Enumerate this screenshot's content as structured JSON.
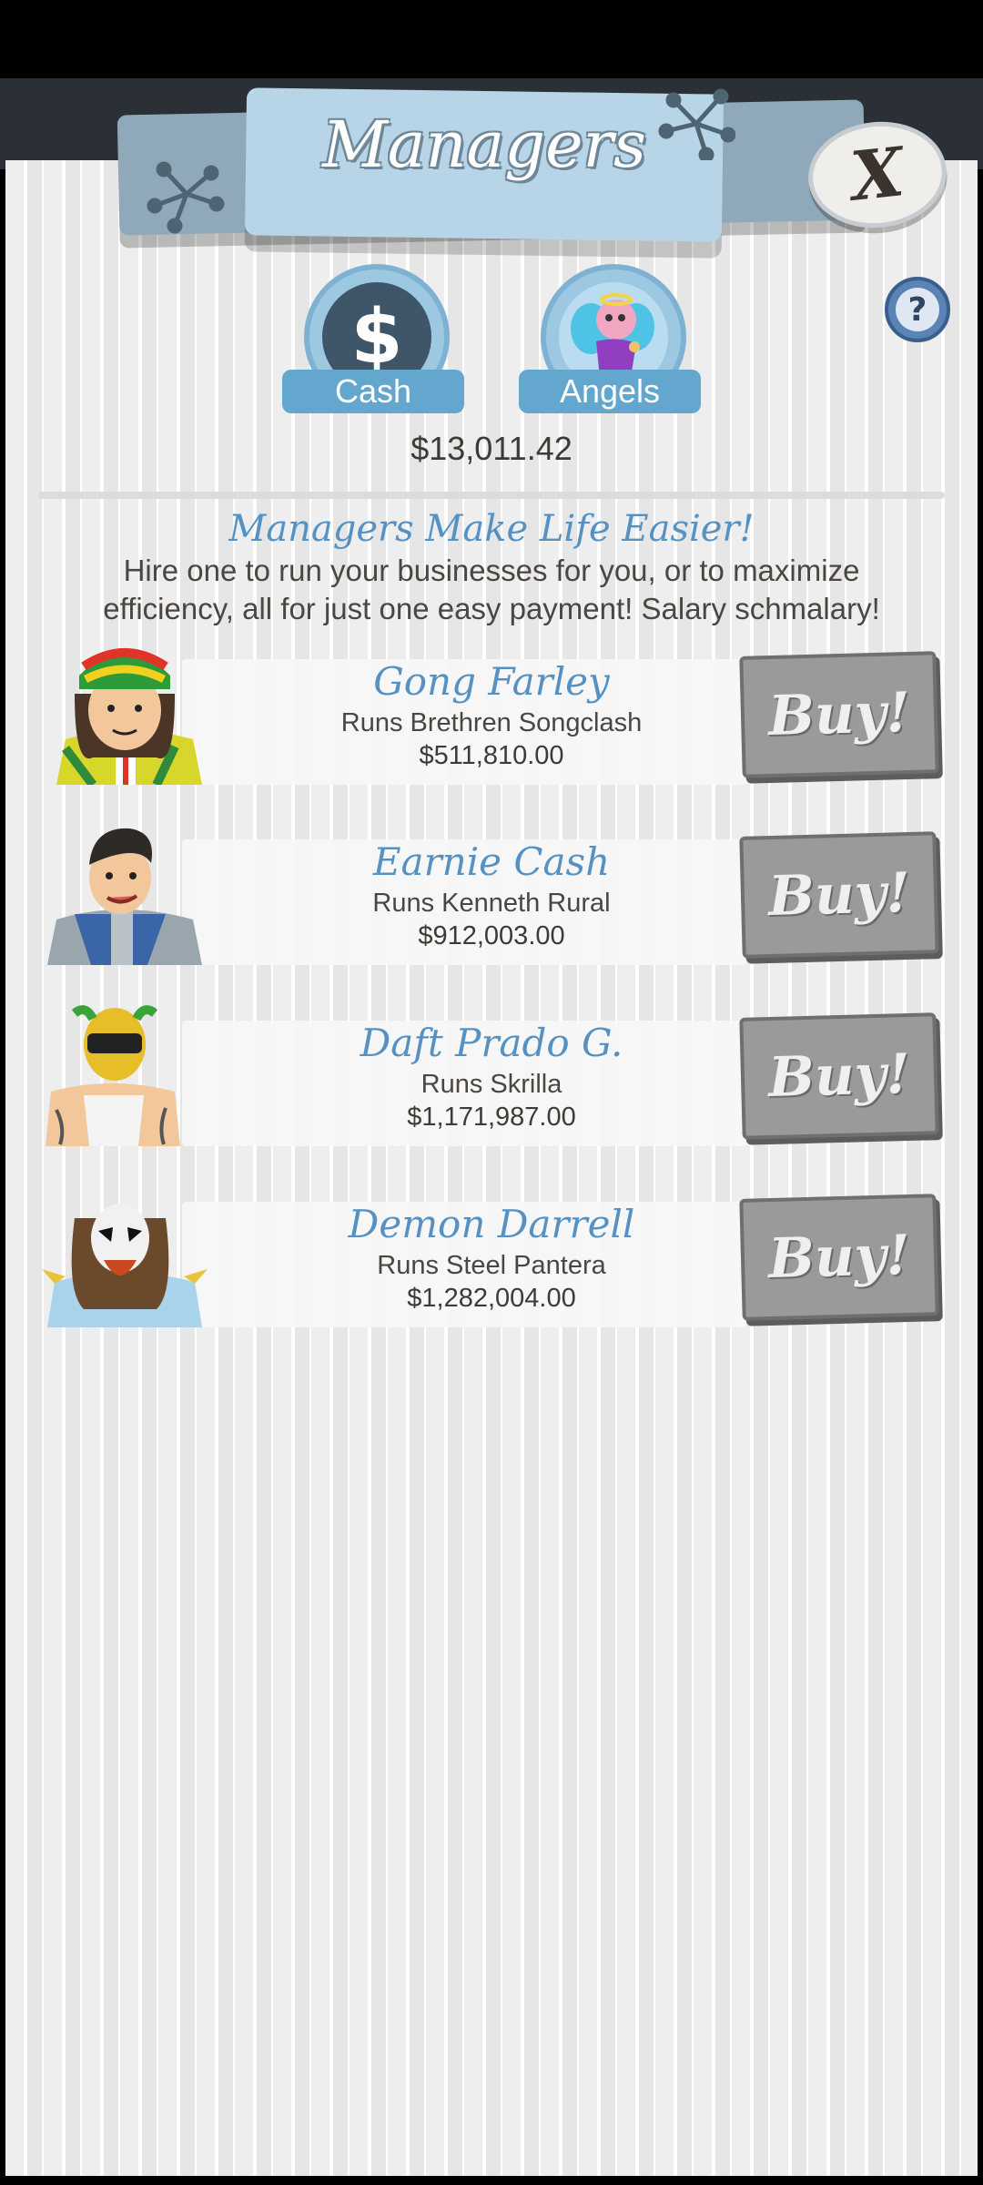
{
  "header": {
    "title": "Managers",
    "close_label": "X",
    "help_label": "?"
  },
  "tabs": [
    {
      "label": "Cash",
      "icon": "dollar-icon"
    },
    {
      "label": "Angels",
      "icon": "angel-icon"
    }
  ],
  "balance": "$13,011.42",
  "promo": {
    "title": "Managers Make Life Easier!",
    "text": "Hire one to run your businesses for you, or to maximize efficiency, all for just one easy payment! Salary schmalary!"
  },
  "managers": [
    {
      "name": "Gong Farley",
      "runs": "Runs Brethren Songclash",
      "price": "$511,810.00",
      "buy_label": "Buy!"
    },
    {
      "name": "Earnie Cash",
      "runs": "Runs Kenneth Rural",
      "price": "$912,003.00",
      "buy_label": "Buy!"
    },
    {
      "name": "Daft Prado G.",
      "runs": "Runs Skrilla",
      "price": "$1,171,987.00",
      "buy_label": "Buy!"
    },
    {
      "name": "Demon Darrell",
      "runs": "Runs Steel Pantera",
      "price": "$1,282,004.00",
      "buy_label": "Buy!"
    }
  ],
  "colors": {
    "accent_blue": "#5592c3",
    "tab_blue": "#63a7cf",
    "buy_gray": "#9a9a9a"
  }
}
